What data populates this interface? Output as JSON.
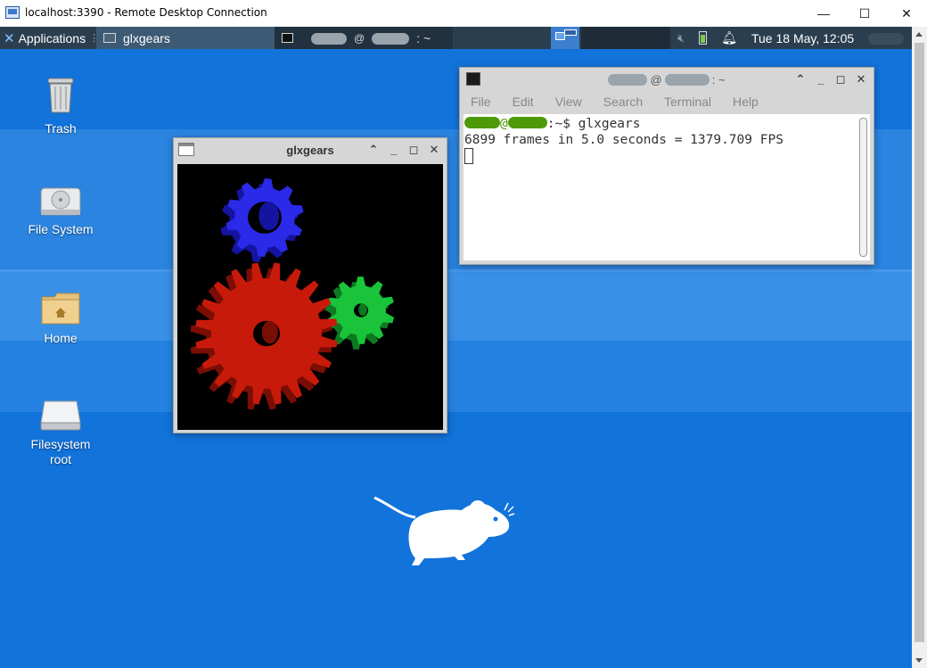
{
  "rdp": {
    "title": "localhost:3390 - Remote Desktop Connection",
    "minimize_glyph": "—",
    "maximize_glyph": "☐",
    "close_glyph": "✕"
  },
  "panel": {
    "applications_label": "Applications",
    "active_task_label": "glxgears",
    "inactive_task_suffix": ": ~",
    "clock": "Tue 18 May, 12:05"
  },
  "desktop_icons": [
    {
      "label": "Trash",
      "icon": "trash-icon"
    },
    {
      "label": "File System",
      "icon": "drive-icon"
    },
    {
      "label": "Home",
      "icon": "home-folder-icon"
    },
    {
      "label": "Filesystem root",
      "icon": "root-drive-icon"
    }
  ],
  "glxgears_window": {
    "title": "glxgears"
  },
  "terminal_window": {
    "title_suffix": ": ~",
    "menu": [
      "File",
      "Edit",
      "View",
      "Search",
      "Terminal",
      "Help"
    ],
    "prompt_suffix": ":~$ ",
    "command": "glxgears",
    "output_line": "6899 frames in 5.0 seconds = 1379.709 FPS"
  },
  "colors": {
    "desktop_bg": "#1273da",
    "panel_bg": "#2b3e50",
    "gear_blue": "#2a2ae8",
    "gear_red": "#c81a0a",
    "gear_green": "#1ac43a"
  }
}
